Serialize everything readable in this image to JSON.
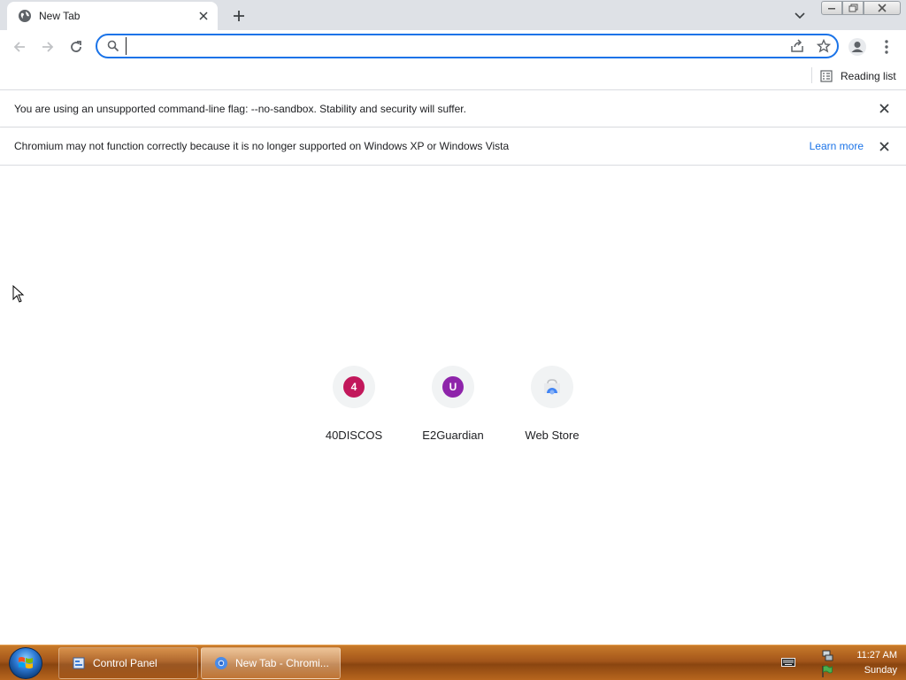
{
  "browser": {
    "tab": {
      "title": "New Tab",
      "favicon": "globe-icon"
    },
    "new_tab_icon": "plus-icon",
    "window_controls": [
      "minimize-icon",
      "maximize-icon",
      "close-icon"
    ]
  },
  "toolbar": {
    "omnibox": {
      "value": "",
      "placeholder": ""
    }
  },
  "bookmarks_bar": {
    "reading_list_label": "Reading list"
  },
  "infobars": [
    {
      "message": "You are using an unsupported command-line flag: --no-sandbox. Stability and security will suffer.",
      "link": ""
    },
    {
      "message": "Chromium may not function correctly because it is no longer supported on Windows XP or Windows Vista",
      "link": "Learn more"
    }
  ],
  "shortcuts": [
    {
      "title": "40DISCOS",
      "letter": "4",
      "color": "#c2185b"
    },
    {
      "title": "E2Guardian",
      "letter": "U",
      "color": "#8e24aa"
    },
    {
      "title": "Web Store",
      "letter": "",
      "color": "#4285f4"
    }
  ],
  "taskbar": {
    "buttons": [
      {
        "label": "Control Panel"
      },
      {
        "label": "New Tab - Chromi..."
      }
    ],
    "clock": {
      "time": "11:27 AM",
      "day": "Sunday"
    }
  },
  "colors": {
    "accent": "#1a73e8",
    "tabstrip": "#dee1e6",
    "taskbar": "#a3561a"
  }
}
